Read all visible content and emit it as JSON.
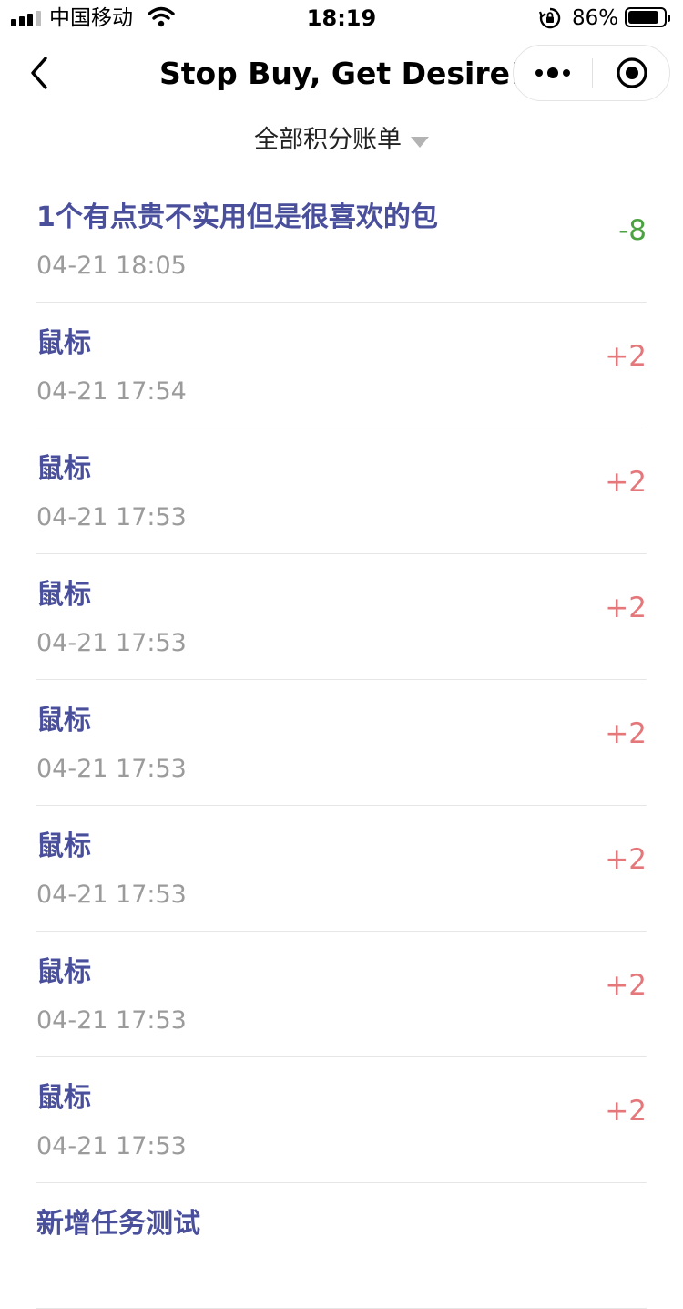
{
  "status_bar": {
    "carrier": "中国移动",
    "time": "18:19",
    "battery": "86%",
    "battery_level": 0.86,
    "icons": [
      "signal-icon",
      "wifi-icon",
      "orientation-lock-icon",
      "battery-icon"
    ]
  },
  "nav": {
    "title": "Stop Buy, Get Desire!",
    "icons": [
      "back-icon",
      "more-icon",
      "close-icon"
    ]
  },
  "filter": {
    "label": "全部积分账单",
    "icon": "caret-down-icon"
  },
  "colors": {
    "title": "#4a4f9c",
    "time": "#9b9b9b",
    "negative": "#4aa340",
    "positive": "#e5777a",
    "divider": "#e6e6e6"
  },
  "records": [
    {
      "title": "1个有点贵不实用但是很喜欢的包",
      "time": "04-21 18:05",
      "points": "-8",
      "type": "negative"
    },
    {
      "title": "鼠标",
      "time": "04-21 17:54",
      "points": "+2",
      "type": "positive"
    },
    {
      "title": "鼠标",
      "time": "04-21 17:53",
      "points": "+2",
      "type": "positive"
    },
    {
      "title": "鼠标",
      "time": "04-21 17:53",
      "points": "+2",
      "type": "positive"
    },
    {
      "title": "鼠标",
      "time": "04-21 17:53",
      "points": "+2",
      "type": "positive"
    },
    {
      "title": "鼠标",
      "time": "04-21 17:53",
      "points": "+2",
      "type": "positive"
    },
    {
      "title": "鼠标",
      "time": "04-21 17:53",
      "points": "+2",
      "type": "positive"
    },
    {
      "title": "鼠标",
      "time": "04-21 17:53",
      "points": "+2",
      "type": "positive"
    },
    {
      "title": "新增任务测试",
      "time": "",
      "points": "",
      "type": "positive"
    }
  ]
}
